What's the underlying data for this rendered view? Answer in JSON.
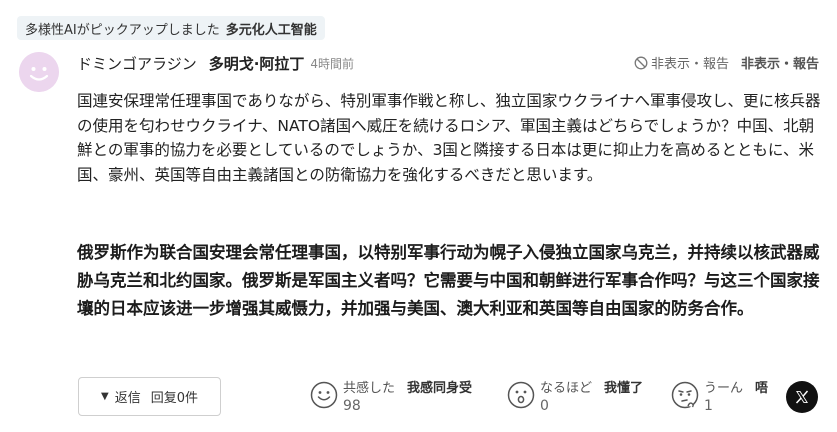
{
  "tag": {
    "label": "多様性AIがピックアップしました",
    "translation": "多元化人工智能"
  },
  "comment": {
    "username": "ドミンゴアラジン",
    "username_translation": "多明戈·阿拉丁",
    "time": "4時間前",
    "hide_report": "非表示・報告",
    "hide_report_translation": "非表示・報告",
    "body_ja": "国連安保理常任理事国でありながら、特別軍事作戦と称し、独立国家ウクライナへ軍事侵攻し、更に核兵器の使用を匂わせウクライナ、NATO諸国へ威圧を続けるロシア、軍国主義はどちらでしょうか？中国、北朝鮮との軍事的協力を必要としているのでしょうか、3国と隣接する日本は更に抑止力を高めるとともに、米国、豪州、英国等自由主義諸国との防衛協力を強化するべきだと思います。",
    "body_zh": "俄罗斯作为联合国安理会常任理事国，以特别军事行动为幌子入侵独立国家乌克兰，并持续以核武器威胁乌克兰和北约国家。俄罗斯是军国主义者吗？它需要与中国和朝鲜进行军事合作吗？与这三个国家接壤的日本应该进一步增强其威慑力，并加强与美国、澳大利亚和英国等自由国家的防务合作。"
  },
  "footer": {
    "reply_label": "返信",
    "reply_translation": "回复",
    "reply_count": "0件",
    "reactions": [
      {
        "label": "共感した",
        "translation": "我感同身受",
        "count": "98",
        "icon": "smile-face-icon"
      },
      {
        "label": "なるほど",
        "translation": "我懂了",
        "count": "0",
        "icon": "surprised-face-icon"
      },
      {
        "label": "うーん",
        "translation": "唔",
        "count": "1",
        "icon": "thinking-face-icon"
      }
    ],
    "share_icon": "x-logo-icon"
  },
  "colors": {
    "avatar_bg": "#ecd6ee",
    "tag_bg": "#eef3f6",
    "share_bg": "#111111"
  }
}
